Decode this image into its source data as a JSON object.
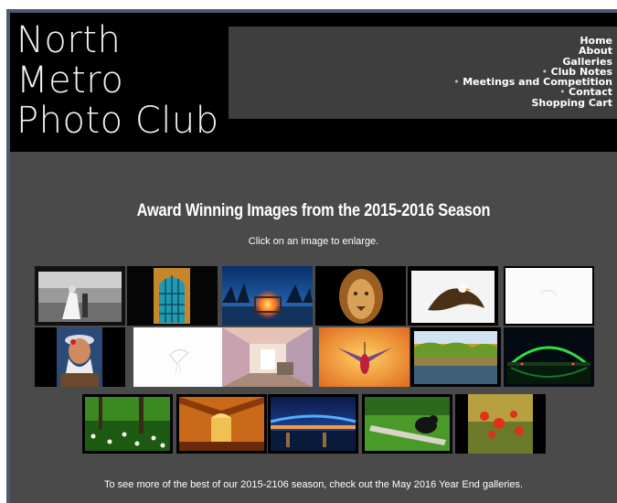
{
  "site": {
    "logo_lines": [
      "North",
      "Metro",
      "Photo Club"
    ]
  },
  "nav": {
    "items": [
      "Home",
      "About",
      "Galleries",
      "Club Notes",
      "Meetings and Competition",
      "Contact",
      "Shopping Cart"
    ]
  },
  "main": {
    "title": "Award Winning Images from the 2015-2016 Season",
    "subtitle": "Click on an image to enlarge.",
    "footer_text": "To see more of the best of our 2015-2106 season, check out the May 2016 Year End galleries."
  },
  "gallery": {
    "thumbnails": [
      "wedding-bw-image",
      "blue-door-image",
      "campfire-night-image",
      "lion-image",
      "eagle-image",
      "white-highkey-image",
      "old-man-portrait-image",
      "bird-sketch-image",
      "abandoned-room-image",
      "hummingbird-image",
      "autumn-lake-image",
      "lit-bridge-night-image",
      "trillium-forest-image",
      "church-interior-image",
      "night-bridge-image",
      "bear-log-image",
      "poppies-image"
    ]
  },
  "colors": {
    "page_bg": "#4a4a4a",
    "header_bg": "#000000",
    "nav_bg": "#3e3e3e",
    "frame": "#4c5a73"
  }
}
